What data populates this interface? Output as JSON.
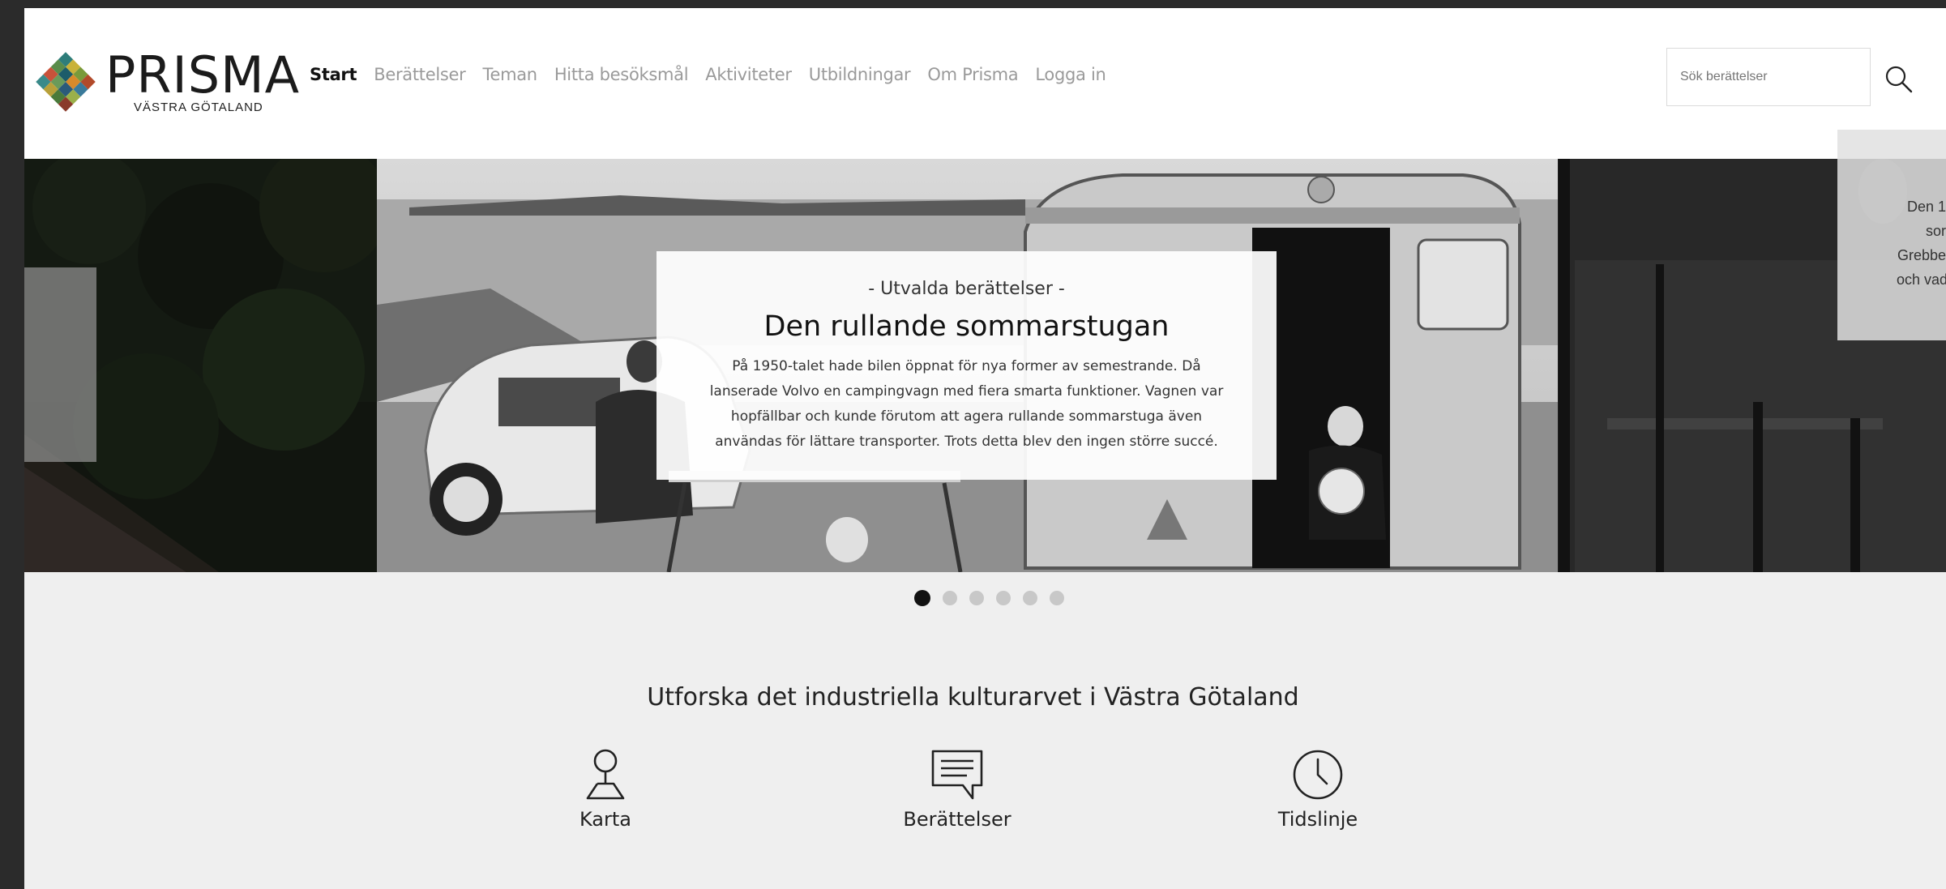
{
  "brand": {
    "name": "PRISMA",
    "subtitle": "VÄSTRA GÖTALAND"
  },
  "nav": {
    "items": [
      {
        "label": "Start",
        "active": true
      },
      {
        "label": "Berättelser"
      },
      {
        "label": "Teman"
      },
      {
        "label": "Hitta besöksmål"
      },
      {
        "label": "Aktiviteter"
      },
      {
        "label": "Utbildningar"
      },
      {
        "label": "Om Prisma"
      },
      {
        "label": "Logga in"
      }
    ]
  },
  "search": {
    "placeholder": "Sök berättelser",
    "icon": "search-icon"
  },
  "carousel": {
    "kicker": "- Utvalda berättelser -",
    "title": "Den rullande sommarstugan",
    "body": "På 1950-talet hade bilen öppnat för nya former av semestrande. Då lanserade Volvo en campingvagn med fiera smarta funktioner. Vagnen var hopfällbar och kunde förutom att agera rullande sommarstuga även användas för lättare transporter. Trots detta blev den ingen större succé.",
    "right_preview_lines": [
      "Den 1",
      "sor",
      "Grebbe",
      "och vad"
    ],
    "active_slide": 1,
    "slide_count": 6
  },
  "explore": {
    "title": "Utforska det industriella kulturarvet i Västra Götaland",
    "features": [
      {
        "label": "Karta",
        "icon": "map-pin-icon"
      },
      {
        "label": "Berättelser",
        "icon": "chat-icon"
      },
      {
        "label": "Tidslinje",
        "icon": "clock-icon"
      }
    ]
  },
  "colors": {
    "background": "#efefef",
    "header": "#ffffff",
    "text": "#222222",
    "nav_inactive": "#9a9a9a"
  }
}
